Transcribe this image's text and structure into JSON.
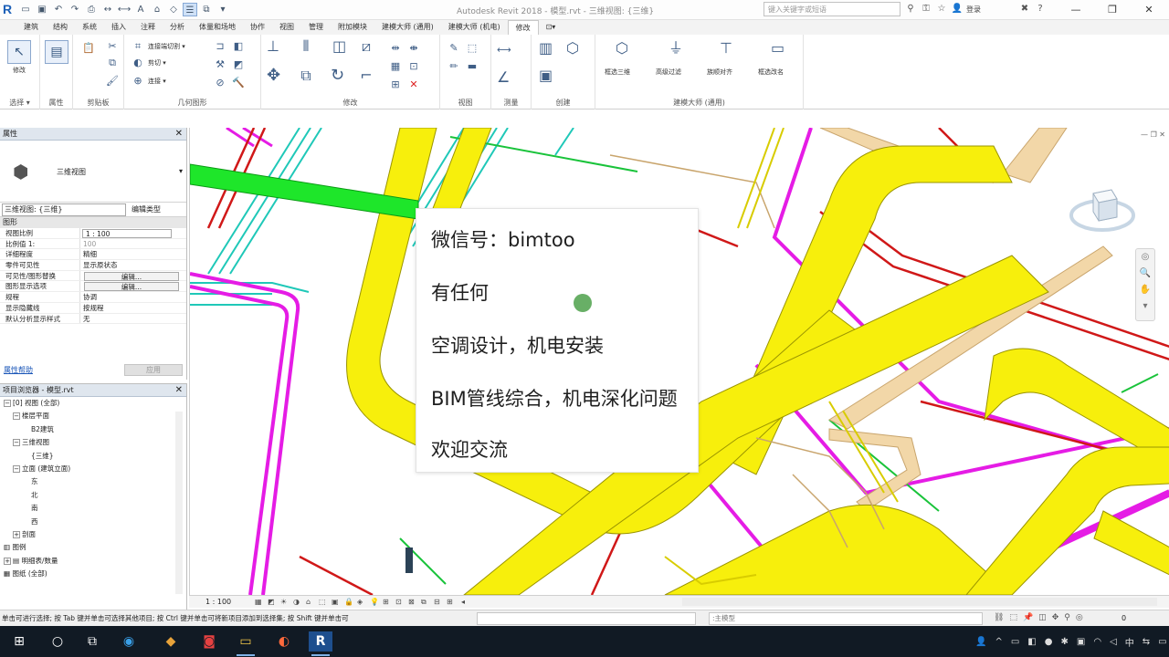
{
  "app": {
    "logo": "R",
    "title": "Autodesk Revit 2018 -   模型.rvt - 三维视图: {三维}",
    "search_placeholder": "键入关键字或短语",
    "login": "登录"
  },
  "tabs": [
    "建筑",
    "结构",
    "系统",
    "插入",
    "注释",
    "分析",
    "体量和场地",
    "协作",
    "视图",
    "管理",
    "附加模块",
    "建模大师 (通用)",
    "建模大师 (机电)",
    "修改",
    "⊡▾"
  ],
  "active_tab": "修改",
  "ribbon": {
    "groups": {
      "select": "选择 ▾",
      "properties": "属性",
      "clipboard": "剪贴板",
      "geometry": "几何图形",
      "modify": "修改",
      "view": "视图",
      "measure": "测量",
      "create": "创建",
      "bimaster": "建模大师 (通用)"
    },
    "tools": {
      "modify_btn": "修改",
      "cope": "连接端切割 ▾",
      "cut": "剪切 ▾",
      "join": "连接 ▾",
      "pick3d": "框选三维",
      "hf": "高级过滤",
      "align": "族顺对齐",
      "boxsel": "框选改名"
    }
  },
  "properties": {
    "title": "属性",
    "type_name": "三维视图",
    "filter_label": "三维视图: {三维}",
    "edit_type": "编辑类型",
    "category": "图形",
    "rows": [
      {
        "k": "视图比例",
        "v": "1 : 100",
        "style": "input"
      },
      {
        "k": "比例值 1:",
        "v": "100",
        "style": "grey"
      },
      {
        "k": "详细程度",
        "v": "精细",
        "style": "plain"
      },
      {
        "k": "零件可见性",
        "v": "显示原状态",
        "style": "plain"
      },
      {
        "k": "可见性/图形替换",
        "v": "编辑...",
        "style": "btn"
      },
      {
        "k": "图形显示选项",
        "v": "编辑...",
        "style": "btn"
      },
      {
        "k": "规程",
        "v": "协调",
        "style": "plain"
      },
      {
        "k": "显示隐藏线",
        "v": "按规程",
        "style": "plain"
      },
      {
        "k": "默认分析显示样式",
        "v": "无",
        "style": "plain"
      }
    ],
    "help_link": "属性帮助",
    "apply": "应用"
  },
  "browser": {
    "title": "项目浏览器 - 模型.rvt",
    "nodes": [
      {
        "indent": 0,
        "exp": "−",
        "label": "[0] 视图 (全部)"
      },
      {
        "indent": 1,
        "exp": "−",
        "label": "楼层平面"
      },
      {
        "indent": 3,
        "exp": "",
        "label": "B2建筑"
      },
      {
        "indent": 1,
        "exp": "−",
        "label": "三维视图"
      },
      {
        "indent": 3,
        "exp": "",
        "label": "{三维}"
      },
      {
        "indent": 1,
        "exp": "−",
        "label": "立面 (建筑立面)"
      },
      {
        "indent": 3,
        "exp": "",
        "label": "东"
      },
      {
        "indent": 3,
        "exp": "",
        "label": "北"
      },
      {
        "indent": 3,
        "exp": "",
        "label": "南"
      },
      {
        "indent": 3,
        "exp": "",
        "label": "西"
      },
      {
        "indent": 1,
        "exp": "+",
        "label": "剖面"
      },
      {
        "indent": 0,
        "exp": "",
        "label": "▥ 图例"
      },
      {
        "indent": 0,
        "exp": "+",
        "label": "▤ 明细表/数量"
      },
      {
        "indent": 0,
        "exp": "",
        "label": "▦ 图纸 (全部)"
      }
    ]
  },
  "card": {
    "lines": [
      "微信号：bimtoo",
      "有任何",
      "空调设计，机电安装",
      "BIM管线综合，机电深化问题",
      "欢迎交流"
    ]
  },
  "viewbar": {
    "scale": "1 : 100"
  },
  "status": {
    "text": "单击可进行选择; 按 Tab 键并单击可选择其他项目; 按 Ctrl 键并单击可将新项目添加到选择集; 按 Shift 键并单击可",
    "model": ":主模型",
    "zero": "0"
  },
  "colors": {
    "duct_yellow": "#f7ef0c",
    "pipe_magenta": "#e51ce5",
    "pipe_red": "#d01818",
    "pipe_green": "#19c33a",
    "pipe_teal": "#1fc8b8",
    "duct_tan": "#f2d7a8",
    "ribbon_accent": "#1b5fb7"
  }
}
